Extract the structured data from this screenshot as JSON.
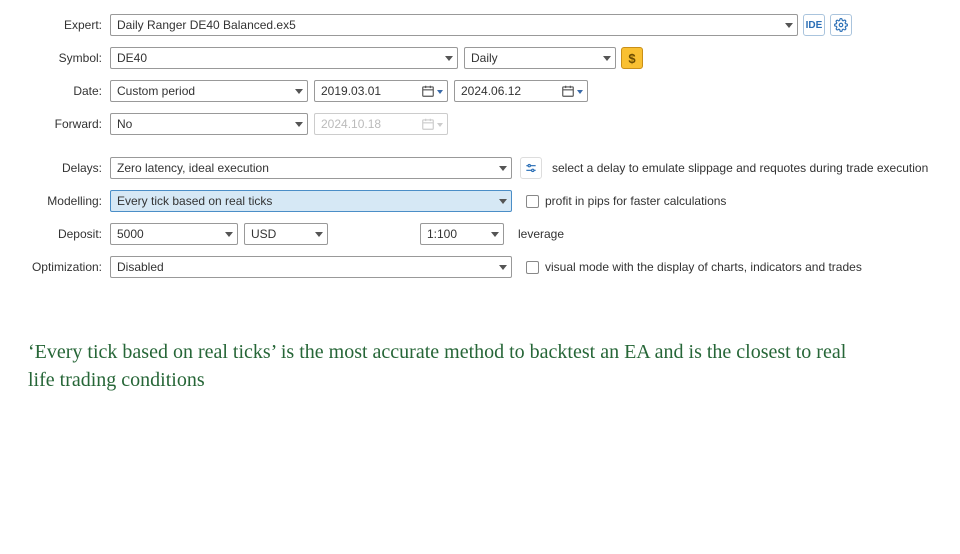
{
  "labels": {
    "expert": "Expert:",
    "symbol": "Symbol:",
    "date": "Date:",
    "forward": "Forward:",
    "delays": "Delays:",
    "modelling": "Modelling:",
    "deposit": "Deposit:",
    "optimization": "Optimization:"
  },
  "expert": {
    "value": "Daily Ranger DE40 Balanced.ex5",
    "ide_label": "IDE"
  },
  "symbol": {
    "value": "DE40",
    "period": "Daily"
  },
  "date": {
    "mode": "Custom period",
    "from": "2019.03.01",
    "to": "2024.06.12"
  },
  "forward": {
    "mode": "No",
    "date": "2024.10.18"
  },
  "delays": {
    "value": "Zero latency, ideal execution",
    "hint": "select a delay to emulate slippage and requotes during trade execution"
  },
  "modelling": {
    "value": "Every tick based on real ticks",
    "pips_label": "profit in pips for faster calculations"
  },
  "deposit": {
    "amount": "5000",
    "currency": "USD",
    "leverage": "1:100",
    "leverage_label": "leverage"
  },
  "optimization": {
    "value": "Disabled",
    "visual_label": "visual mode with the display of charts, indicators and trades"
  },
  "caption": "‘Every tick based on real ticks’ is the most accurate method to backtest an EA and is the closest to real life trading conditions"
}
